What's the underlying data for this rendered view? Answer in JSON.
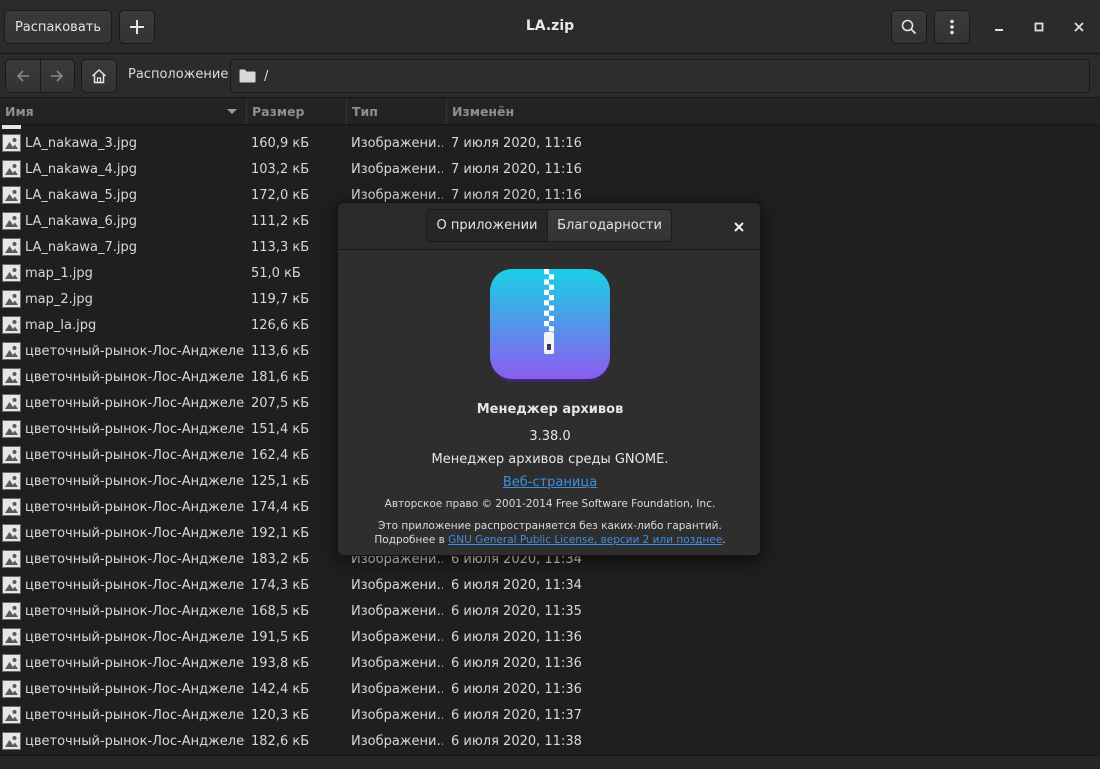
{
  "window": {
    "title": "LA.zip"
  },
  "header": {
    "extract_label": "Распаковать",
    "add_icon": "plus-icon",
    "search_icon": "search-icon",
    "menu_icon": "kebab-menu-icon"
  },
  "location": {
    "label": "Расположение:",
    "path": "/",
    "folder_icon": "folder-icon"
  },
  "columns": {
    "name": "Имя",
    "size": "Размер",
    "type": "Тип",
    "modified": "Изменён"
  },
  "files": [
    {
      "name": "LA_nakawa_3.jpg",
      "size": "160,9 кБ",
      "type": "Изображени…",
      "modified": "7 июля 2020, 11:16"
    },
    {
      "name": "LA_nakawa_4.jpg",
      "size": "103,2 кБ",
      "type": "Изображени…",
      "modified": "7 июля 2020, 11:16"
    },
    {
      "name": "LA_nakawa_5.jpg",
      "size": "172,0 кБ",
      "type": "Изображени…",
      "modified": "7 июля 2020, 11:16"
    },
    {
      "name": "LA_nakawa_6.jpg",
      "size": "111,2 кБ",
      "type": "",
      "modified": ""
    },
    {
      "name": "LA_nakawa_7.jpg",
      "size": "113,3 кБ",
      "type": "",
      "modified": ""
    },
    {
      "name": "map_1.jpg",
      "size": "51,0 кБ",
      "type": "",
      "modified": ""
    },
    {
      "name": "map_2.jpg",
      "size": "119,7 кБ",
      "type": "",
      "modified": ""
    },
    {
      "name": "map_la.jpg",
      "size": "126,6 кБ",
      "type": "",
      "modified": ""
    },
    {
      "name": "цветочный-рынок-Лос-Анджелеса…",
      "size": "113,6 кБ",
      "type": "",
      "modified": ""
    },
    {
      "name": "цветочный-рынок-Лос-Анджелеса…",
      "size": "181,6 кБ",
      "type": "",
      "modified": ""
    },
    {
      "name": "цветочный-рынок-Лос-Анджелеса…",
      "size": "207,5 кБ",
      "type": "",
      "modified": ""
    },
    {
      "name": "цветочный-рынок-Лос-Анджелеса…",
      "size": "151,4 кБ",
      "type": "",
      "modified": ""
    },
    {
      "name": "цветочный-рынок-Лос-Анджелеса…",
      "size": "162,4 кБ",
      "type": "",
      "modified": ""
    },
    {
      "name": "цветочный-рынок-Лос-Анджелеса…",
      "size": "125,1 кБ",
      "type": "",
      "modified": ""
    },
    {
      "name": "цветочный-рынок-Лос-Анджелеса…",
      "size": "174,4 кБ",
      "type": "",
      "modified": ""
    },
    {
      "name": "цветочный-рынок-Лос-Анджелеса…",
      "size": "192,1 кБ",
      "type": "",
      "modified": ""
    },
    {
      "name": "цветочный-рынок-Лос-Анджелеса…",
      "size": "183,2 кБ",
      "type": "Изображени…",
      "modified": "6 июля 2020, 11:34"
    },
    {
      "name": "цветочный-рынок-Лос-Анджелеса…",
      "size": "174,3 кБ",
      "type": "Изображени…",
      "modified": "6 июля 2020, 11:34"
    },
    {
      "name": "цветочный-рынок-Лос-Анджелеса…",
      "size": "168,5 кБ",
      "type": "Изображени…",
      "modified": "6 июля 2020, 11:35"
    },
    {
      "name": "цветочный-рынок-Лос-Анджелеса…",
      "size": "191,5 кБ",
      "type": "Изображени…",
      "modified": "6 июля 2020, 11:36"
    },
    {
      "name": "цветочный-рынок-Лос-Анджелеса…",
      "size": "193,8 кБ",
      "type": "Изображени…",
      "modified": "6 июля 2020, 11:36"
    },
    {
      "name": "цветочный-рынок-Лос-Анджелеса…",
      "size": "142,4 кБ",
      "type": "Изображени…",
      "modified": "6 июля 2020, 11:36"
    },
    {
      "name": "цветочный-рынок-Лос-Анджелеса…",
      "size": "120,3 кБ",
      "type": "Изображени…",
      "modified": "6 июля 2020, 11:37"
    },
    {
      "name": "цветочный-рынок-Лос-Анджелеса…",
      "size": "182,6 кБ",
      "type": "Изображени…",
      "modified": "6 июля 2020, 11:38"
    }
  ],
  "about": {
    "tab_about": "О приложении",
    "tab_credits": "Благодарности",
    "app_name": "Менеджер архивов",
    "version": "3.38.0",
    "comments": "Менеджер архивов среды GNOME.",
    "website_label": "Веб-страница",
    "copyright": "Авторское право © 2001-2014 Free Software Foundation, Inc.",
    "license_line1": "Это приложение распространяется без каких-либо гарантий.",
    "license_prefix": "Подробнее в ",
    "license_link": "GNU General Public License, версии 2 или позднее",
    "license_suffix": ".",
    "icon_name": "archive-manager-app-icon",
    "icon_colors": {
      "top": "#19d0e4",
      "bottom": "#8b5cf0"
    }
  }
}
